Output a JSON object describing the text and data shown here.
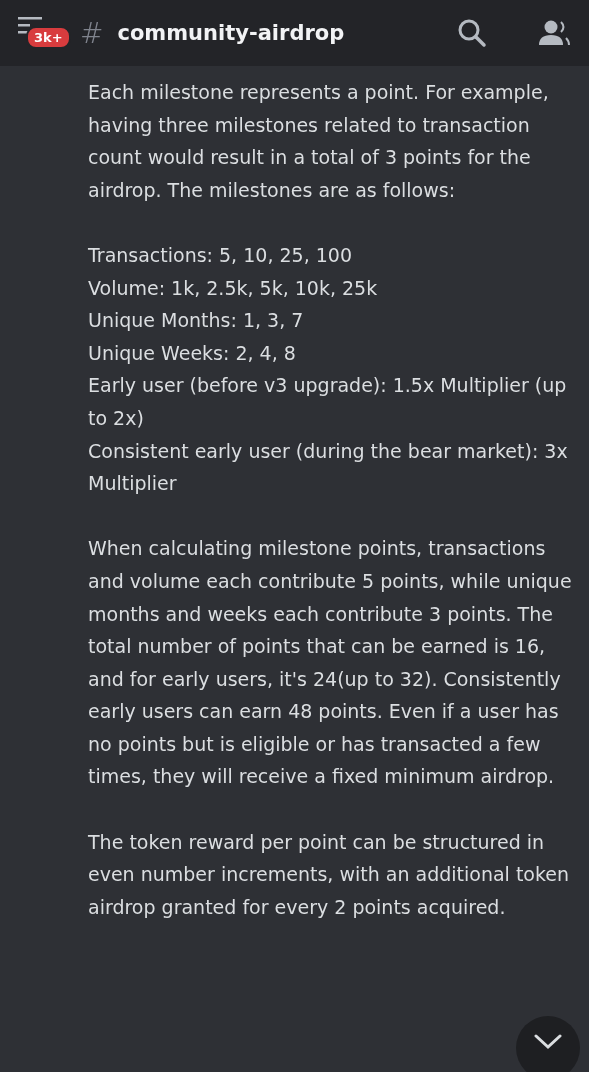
{
  "header": {
    "badge": "3k+",
    "hash": "#",
    "channel": "community-airdrop"
  },
  "message": {
    "paragraphs": [
      {
        "kind": "text",
        "text": "Each milestone represents a point. For example, having three milestones related to transaction count would result in a total of 3 points for the airdrop. The milestones are as follows:"
      },
      {
        "kind": "list",
        "lines": [
          "Transactions: 5, 10, 25, 100",
          "Volume: 1k, 2.5k, 5k, 10k, 25k",
          "Unique Months: 1, 3, 7",
          "Unique Weeks: 2, 4, 8",
          "Early user (before v3 upgrade): 1.5x Multiplier (up to 2x)",
          "Consistent early user (during the bear market): 3x Multiplier"
        ]
      },
      {
        "kind": "text",
        "text": "When calculating milestone points, transactions and volume each contribute 5 points, while unique months and weeks each contribute 3 points. The total number of points that can be earned is 16, and for early users, it's 24(up to 32). Consistently early users can earn 48 points. Even if a user has no points but is eligible or has transacted a few times, they will receive a fixed minimum airdrop."
      },
      {
        "kind": "text",
        "text": "The token reward per point can be structured in even number increments, with an additional token airdrop granted for every 2 points acquired."
      }
    ]
  }
}
